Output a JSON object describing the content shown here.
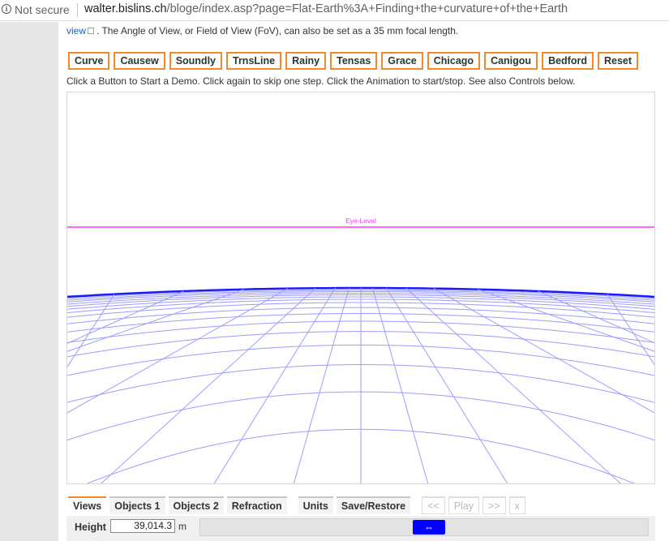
{
  "browser": {
    "security_text": "Not secure",
    "url_host": "walter.bislins.ch",
    "url_path": "/bloge/index.asp?page=Flat-Earth%3A+Finding+the+curvature+of+the+Earth",
    "info_icon": "info-circle-icon"
  },
  "intro": {
    "link_text": "view",
    "text": ". The Angle of View, or Field of View (FoV), can also be set as a 35 mm focal length."
  },
  "demo_buttons": [
    "Curve",
    "Causew",
    "Soundly",
    "TrnsLine",
    "Rainy",
    "Tensas",
    "Grace",
    "Chicago",
    "Canigou",
    "Bedford",
    "Reset"
  ],
  "hint": "Click a Button to Start a Demo. Click again to skip one step. Click the Animation to start/stop. See also Controls below.",
  "canvas": {
    "eye_level_label": "Eye-Level",
    "eye_level_color": "#ff33ff",
    "horizon_color": "#1a1aff",
    "grid_color": "#9c9cff"
  },
  "tabs": [
    {
      "label": "Views",
      "active": true,
      "enabled": true
    },
    {
      "label": "Objects 1",
      "active": false,
      "enabled": true
    },
    {
      "label": "Objects 2",
      "active": false,
      "enabled": true
    },
    {
      "label": "Refraction",
      "active": false,
      "enabled": true
    },
    {
      "label": "Units",
      "active": false,
      "enabled": true
    },
    {
      "label": "Save/Restore",
      "active": false,
      "enabled": true
    },
    {
      "label": "<<",
      "active": false,
      "enabled": false
    },
    {
      "label": "Play",
      "active": false,
      "enabled": false
    },
    {
      "label": ">>",
      "active": false,
      "enabled": false
    },
    {
      "label": "x",
      "active": false,
      "enabled": false
    }
  ],
  "height_control": {
    "label": "Height",
    "value": "39,014.3",
    "unit": "m",
    "slider_thumb": "⇔"
  }
}
